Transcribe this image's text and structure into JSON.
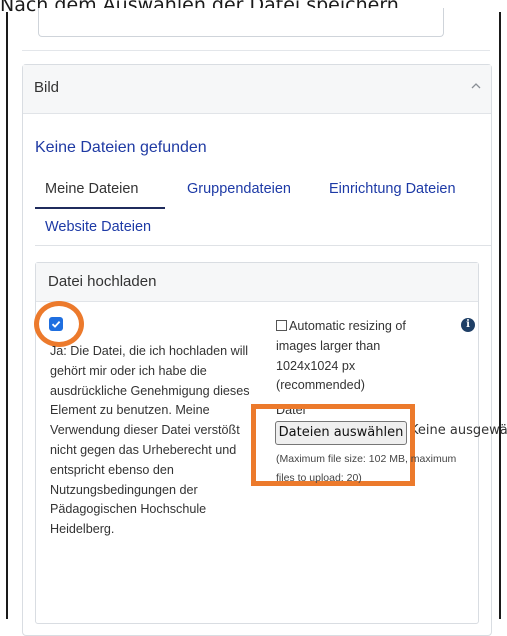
{
  "caption": "Nach dem Auswählen der Datei speichern",
  "section": {
    "title": "Bild",
    "empty_message": "Keine Dateien gefunden",
    "tabs": [
      {
        "label": "Meine Dateien"
      },
      {
        "label": "Gruppendateien"
      },
      {
        "label": "Einrichtung Dateien"
      },
      {
        "label": "Website Dateien"
      }
    ]
  },
  "upload": {
    "title": "Datei hochladen",
    "consent_checked": true,
    "consent_text": "Ja: Die Datei, die ich hochladen will gehört mir oder ich habe die ausdrückliche Genehmigung dieses Element zu benutzen. Meine Verwendung dieser Datei verstößt nicht gegen das Urheberecht und entspricht ebenso den Nutzungsbedingungen der Pädagogischen Hochschule Heidelberg.",
    "resize_checked": false,
    "resize_text": "Automatic resizing of images larger than 1024x1024 px (recommended)",
    "file_label": "Datei",
    "choose_button": "Dateien auswählen",
    "no_file_text": "Keine ausgewählt",
    "limits_text": "(Maximum file size: 102 MB, maximum files to upload: 20)"
  },
  "colors": {
    "highlight": "#ec7a2c",
    "link": "#1d3aa6",
    "checkbox": "#1f6fe0"
  },
  "icons": {
    "collapse": "chevron-up-icon",
    "info": "info-icon",
    "check": "check-icon"
  }
}
